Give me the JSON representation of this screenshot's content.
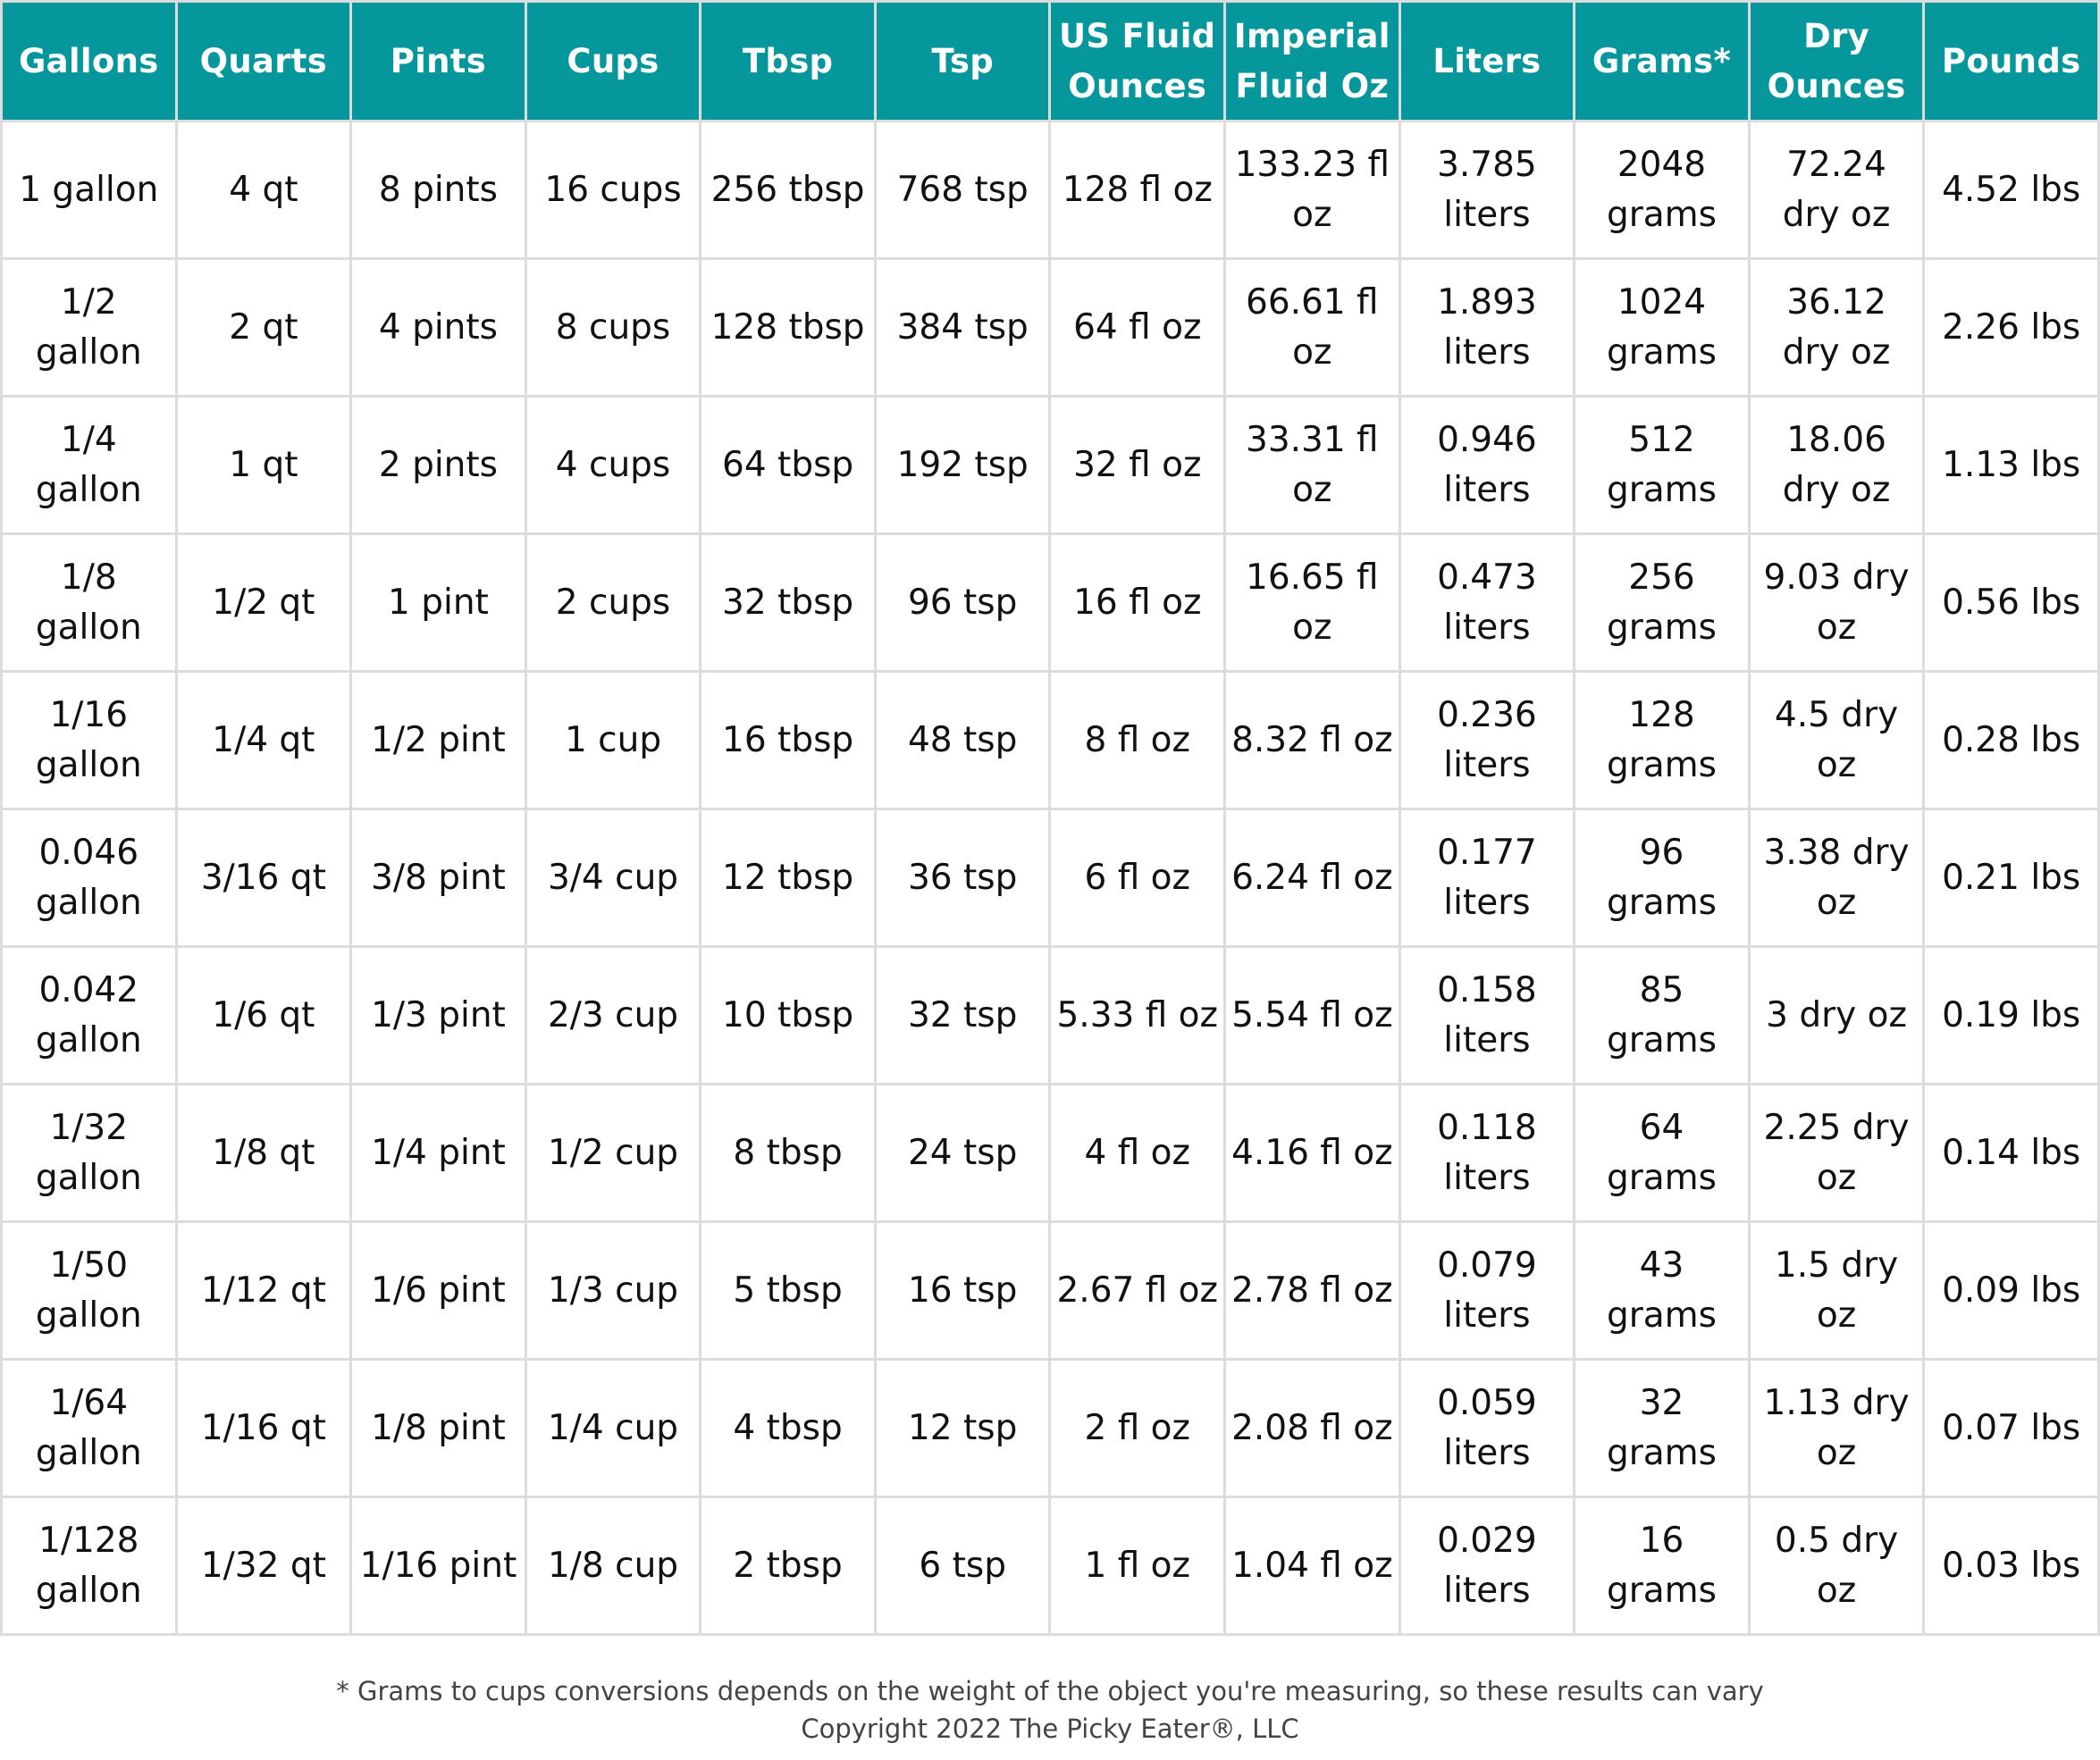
{
  "table": {
    "header_color": "#05979C",
    "columns": [
      "Gallons",
      "Quarts",
      "Pints",
      "Cups",
      "Tbsp",
      "Tsp",
      "US Fluid Ounces",
      "Imperial Fluid Oz",
      "Liters",
      "Grams*",
      "Dry Ounces",
      "Pounds"
    ],
    "rows": [
      [
        "1 gallon",
        "4 qt",
        "8 pints",
        "16 cups",
        "256 tbsp",
        "768 tsp",
        "128 fl oz",
        "133.23 fl oz",
        "3.785 liters",
        "2048 grams",
        "72.24 dry oz",
        "4.52 lbs"
      ],
      [
        "1/2 gallon",
        "2 qt",
        "4 pints",
        "8 cups",
        "128 tbsp",
        "384 tsp",
        "64 fl oz",
        "66.61 fl oz",
        "1.893 liters",
        "1024 grams",
        "36.12 dry oz",
        "2.26 lbs"
      ],
      [
        "1/4 gallon",
        "1 qt",
        "2 pints",
        "4 cups",
        "64 tbsp",
        "192 tsp",
        "32 fl oz",
        "33.31 fl oz",
        "0.946 liters",
        "512 grams",
        "18.06 dry oz",
        "1.13 lbs"
      ],
      [
        "1/8 gallon",
        "1/2 qt",
        "1 pint",
        "2 cups",
        "32 tbsp",
        "96 tsp",
        "16 fl oz",
        "16.65 fl oz",
        "0.473 liters",
        "256 grams",
        "9.03 dry oz",
        "0.56 lbs"
      ],
      [
        "1/16 gallon",
        "1/4 qt",
        "1/2 pint",
        "1 cup",
        "16 tbsp",
        "48 tsp",
        "8 fl oz",
        "8.32 fl oz",
        "0.236 liters",
        "128 grams",
        "4.5 dry oz",
        "0.28 lbs"
      ],
      [
        "0.046 gallon",
        "3/16 qt",
        "3/8 pint",
        "3/4 cup",
        "12 tbsp",
        "36 tsp",
        "6 fl oz",
        "6.24 fl oz",
        "0.177 liters",
        "96 grams",
        "3.38 dry oz",
        "0.21 lbs"
      ],
      [
        "0.042 gallon",
        "1/6 qt",
        "1/3 pint",
        "2/3 cup",
        "10 tbsp",
        "32 tsp",
        "5.33 fl oz",
        "5.54 fl oz",
        "0.158 liters",
        "85 grams",
        "3 dry oz",
        "0.19 lbs"
      ],
      [
        "1/32 gallon",
        "1/8 qt",
        "1/4 pint",
        "1/2 cup",
        "8 tbsp",
        "24 tsp",
        "4 fl oz",
        "4.16 fl oz",
        "0.118 liters",
        "64 grams",
        "2.25 dry oz",
        "0.14 lbs"
      ],
      [
        "1/50 gallon",
        "1/12 qt",
        "1/6 pint",
        "1/3 cup",
        "5 tbsp",
        "16 tsp",
        "2.67 fl oz",
        "2.78 fl oz",
        "0.079 liters",
        "43 grams",
        "1.5 dry oz",
        "0.09 lbs"
      ],
      [
        "1/64 gallon",
        "1/16 qt",
        "1/8 pint",
        "1/4 cup",
        "4 tbsp",
        "12 tsp",
        "2 fl oz",
        "2.08 fl oz",
        "0.059 liters",
        "32 grams",
        "1.13 dry oz",
        "0.07 lbs"
      ],
      [
        "1/128 gallon",
        "1/32 qt",
        "1/16 pint",
        "1/8 cup",
        "2 tbsp",
        "6 tsp",
        "1 fl oz",
        "1.04 fl oz",
        "0.029 liters",
        "16 grams",
        "0.5 dry oz",
        "0.03 lbs"
      ]
    ]
  },
  "footer": {
    "note": "* Grams to cups conversions depends on the weight of the object you're measuring, so these results can vary",
    "copyright": "Copyright 2022 The Picky Eater®, LLC"
  }
}
